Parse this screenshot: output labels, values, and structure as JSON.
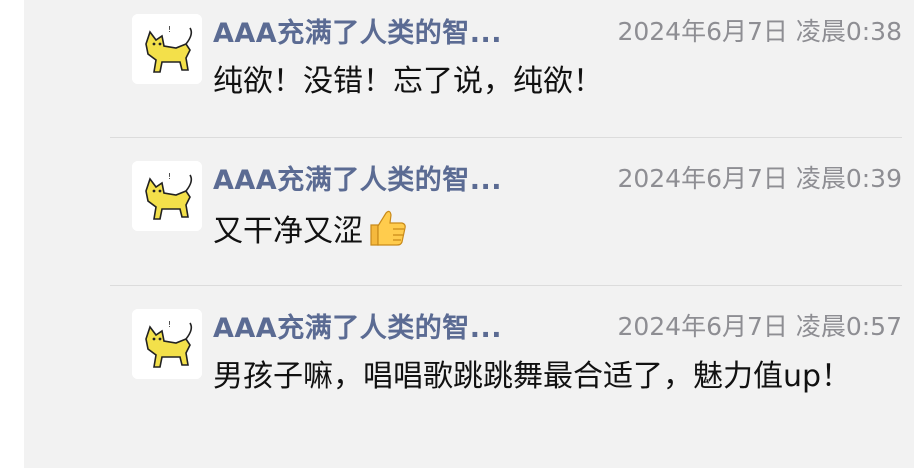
{
  "comments": [
    {
      "author": "AAA充满了人类的智...",
      "time": "2024年6月7日 凌晨0:38",
      "text": "纯欲！没错！忘了说，纯欲！",
      "emoji": ""
    },
    {
      "author": "AAA充满了人类的智...",
      "time": "2024年6月7日 凌晨0:39",
      "text": "又干净又涩",
      "emoji": "thumbs-up-icon"
    },
    {
      "author": "AAA充满了人类的智...",
      "time": "2024年6月7日 凌晨0:57",
      "text": "男孩子嘛，唱唱歌跳跳舞最合适了，魅力值up！",
      "emoji": ""
    }
  ],
  "colors": {
    "author": "#5b6b93",
    "time": "#8e8e93",
    "panel": "#f2f2f2",
    "divider": "#dcdcdc",
    "avatar_cat": "#f3e04a"
  }
}
